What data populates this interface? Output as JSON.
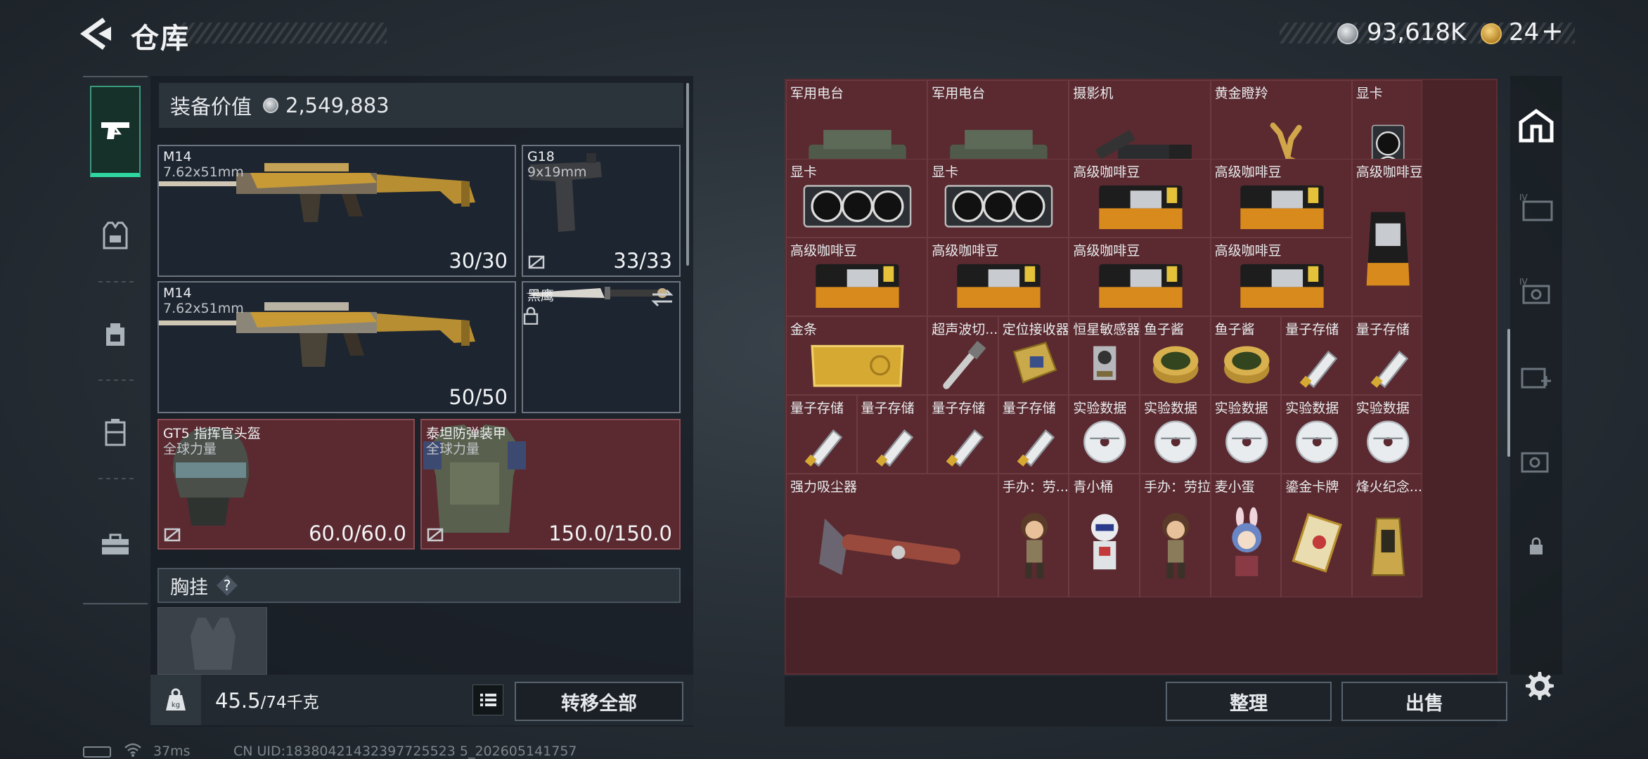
{
  "header": {
    "title": "仓库",
    "money": "93,618K",
    "tickets": "24",
    "plus": "+"
  },
  "equipment_value": {
    "label": "装备价值",
    "value": "2,549,883"
  },
  "slots": {
    "primary1": {
      "name": "M14",
      "caliber": "7.62x51mm",
      "durability": "30/30"
    },
    "sidearm": {
      "name": "G18",
      "caliber": "9x19mm",
      "durability": "33/33"
    },
    "primary2": {
      "name": "M14",
      "caliber": "7.62x51mm",
      "durability": "50/50"
    },
    "melee": {
      "name": "黑鹰"
    },
    "helmet": {
      "name": "GT5 指挥官头盔",
      "sub": "全球力量",
      "durability": "60.0/60.0"
    },
    "armor": {
      "name": "泰坦防弹装甲",
      "sub": "全球力量",
      "durability": "150.0/150.0"
    }
  },
  "chest_rig": {
    "label": "胸挂",
    "help": "?"
  },
  "weight": {
    "current": "45.5",
    "max": "/74千克"
  },
  "buttons": {
    "transfer_all": "转移全部",
    "sort": "整理",
    "sell": "出售"
  },
  "items": [
    {
      "label": "军用电台",
      "icon": "radio"
    },
    {
      "label": "军用电台",
      "icon": "radio"
    },
    {
      "label": "摄影机",
      "icon": "camera"
    },
    {
      "label": "黄金瞪羚",
      "icon": "gazelle"
    },
    {
      "label": "显卡",
      "icon": "gpu-vertical"
    },
    {
      "label": "显卡",
      "icon": "gpu"
    },
    {
      "label": "显卡",
      "icon": "gpu"
    },
    {
      "label": "高级咖啡豆",
      "icon": "coffee"
    },
    {
      "label": "高级咖啡豆",
      "icon": "coffee"
    },
    {
      "label": "高级咖啡豆",
      "icon": "coffee-bag"
    },
    {
      "label": "高级咖啡豆",
      "icon": "coffee"
    },
    {
      "label": "高级咖啡豆",
      "icon": "coffee"
    },
    {
      "label": "高级咖啡豆",
      "icon": "coffee"
    },
    {
      "label": "高级咖啡豆",
      "icon": "coffee"
    },
    {
      "label": "金条",
      "icon": "gold-bar"
    },
    {
      "label": "超声波切...",
      "icon": "cutter"
    },
    {
      "label": "定位接收器",
      "icon": "receiver"
    },
    {
      "label": "恒星敏感器",
      "icon": "sensor"
    },
    {
      "label": "鱼子酱",
      "icon": "caviar"
    },
    {
      "label": "鱼子酱",
      "icon": "caviar"
    },
    {
      "label": "量子存储",
      "icon": "usb"
    },
    {
      "label": "量子存储",
      "icon": "usb"
    },
    {
      "label": "量子存储",
      "icon": "usb"
    },
    {
      "label": "量子存储",
      "icon": "usb"
    },
    {
      "label": "量子存储",
      "icon": "usb"
    },
    {
      "label": "量子存储",
      "icon": "usb"
    },
    {
      "label": "实验数据",
      "icon": "disc"
    },
    {
      "label": "实验数据",
      "icon": "disc"
    },
    {
      "label": "实验数据",
      "icon": "disc"
    },
    {
      "label": "实验数据",
      "icon": "disc"
    },
    {
      "label": "实验数据",
      "icon": "disc"
    },
    {
      "label": "强力吸尘器",
      "icon": "vacuum"
    },
    {
      "label": "手办：劳...",
      "icon": "figure-girl"
    },
    {
      "label": "青小桶",
      "icon": "figure-robot"
    },
    {
      "label": "手办：劳拉",
      "icon": "figure-girl"
    },
    {
      "label": "麦小蛋",
      "icon": "figure-bunny"
    },
    {
      "label": "鎏金卡牌",
      "icon": "card"
    },
    {
      "label": "烽火纪念...",
      "icon": "memorial"
    }
  ],
  "status": {
    "ping": "37ms",
    "uid": "CN UID:18380421432397725523 5_202605141757"
  },
  "colors": {
    "accent": "#2fd6a0",
    "item_bg": "#5a2a30"
  }
}
